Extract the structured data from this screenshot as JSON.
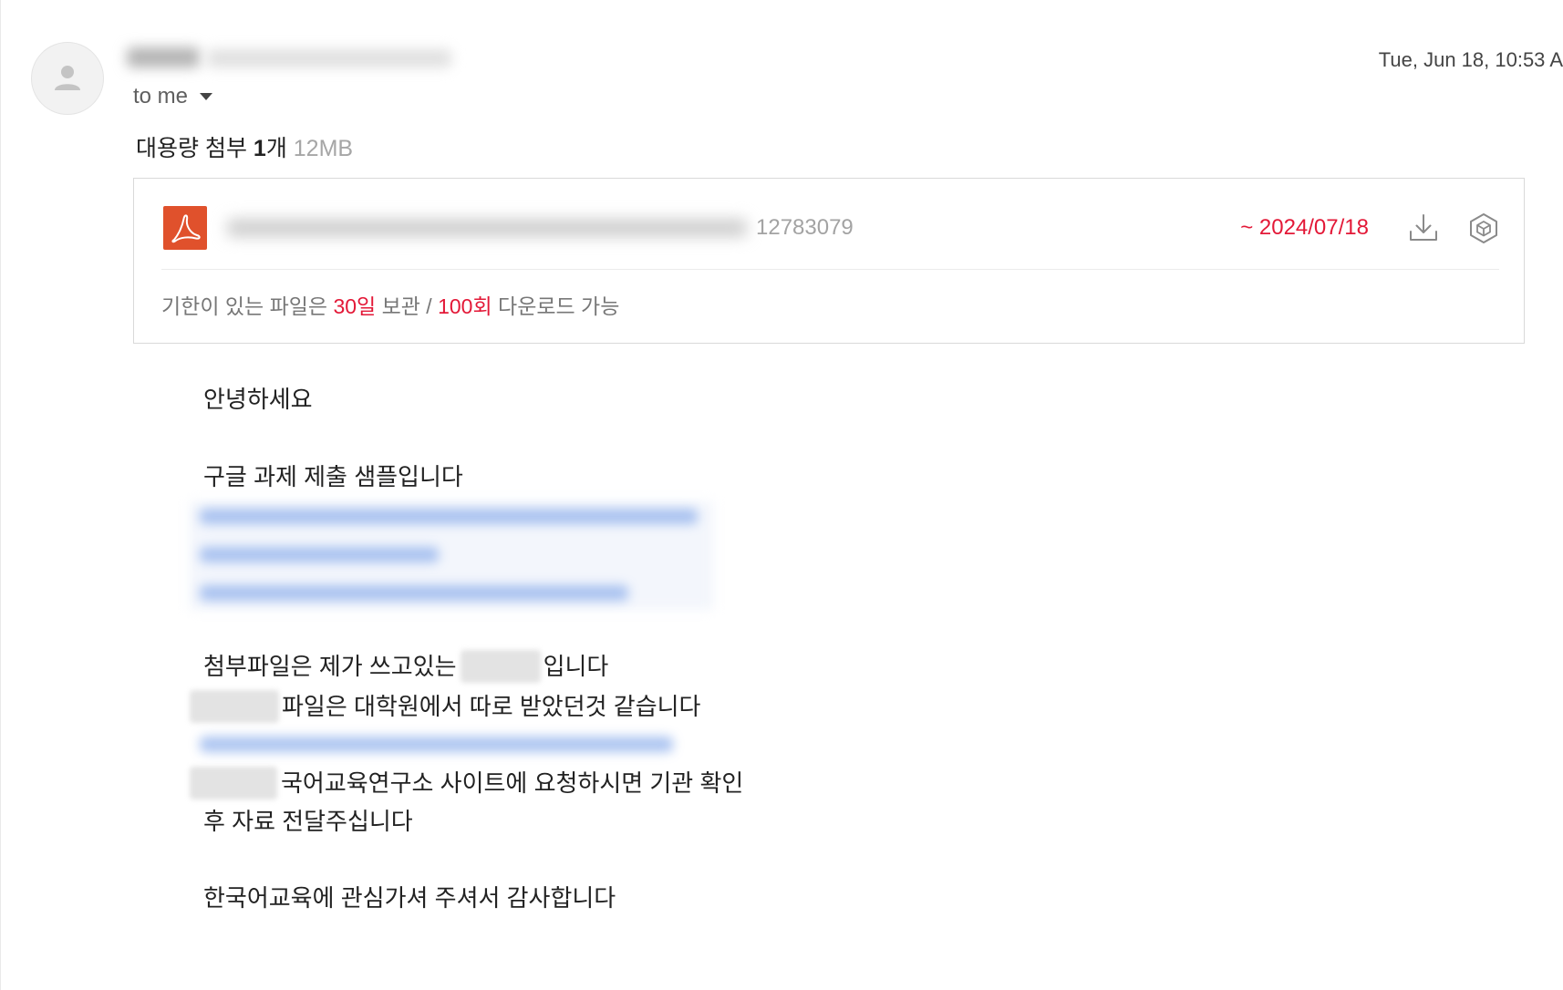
{
  "header": {
    "avatar_icon": "person-icon",
    "recipient_label": "to me",
    "recipient_toggle_icon": "caret-down-icon",
    "date": "Tue, Jun 18, 10:53 A"
  },
  "attachments": {
    "heading": "대용량 첨부 ",
    "count": "1",
    "count_unit": "개",
    "total_size": " 12MB",
    "file": {
      "type_icon": "pdf-icon",
      "size": "12783079",
      "expiry": "~ 2024/07/18",
      "download_icon": "download-icon",
      "save_icon": "cube-icon"
    },
    "note": {
      "prefix": "기한이 있는 파일은 ",
      "days": "30일",
      "middle": " 보관 / ",
      "downloads": "100회",
      "suffix": " 다운로드 가능"
    }
  },
  "body": {
    "greeting": "안녕하세요",
    "line1": "구글 과제 제출 샘플입니다",
    "line2_start": "첨부파일은 제가 쓰고있는",
    "line2_end": "입니다",
    "line3": "파일은 대학원에서 따로 받았던것 같습니다",
    "line4": "국어교육연구소 사이트에 요청하시면 기관 확인",
    "line5": "후 자료 전달주십니다",
    "closing": "한국어교육에 관심가셔 주셔서 감사합니다"
  },
  "colors": {
    "accent_red": "#e31837",
    "pdf_red": "#e0512c",
    "muted_gray": "#a3a3a3",
    "link_blue": "#8fb0ec"
  }
}
